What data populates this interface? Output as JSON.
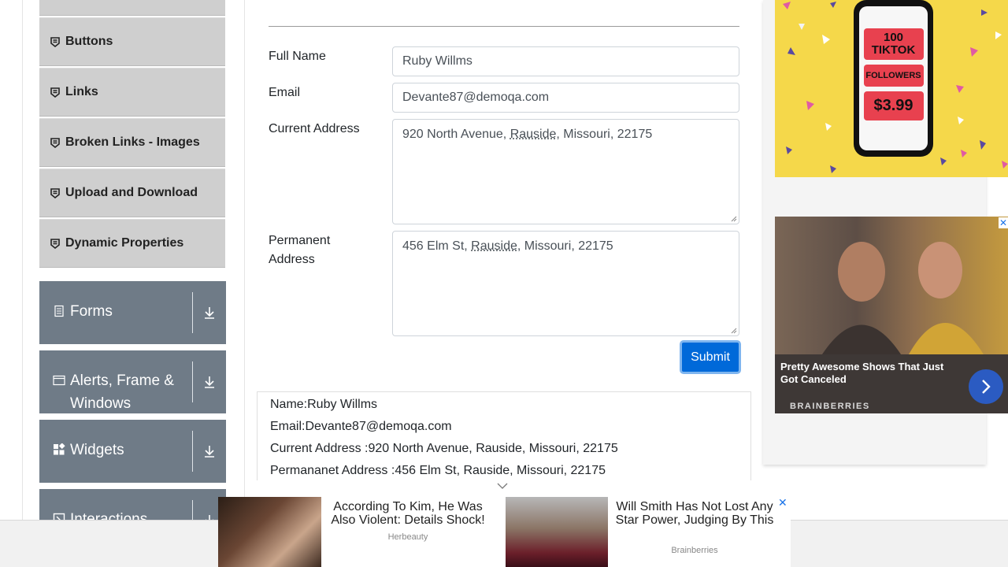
{
  "sidebar": {
    "element_items": [
      {
        "label": ""
      },
      {
        "label": "Buttons"
      },
      {
        "label": "Links"
      },
      {
        "label": "Broken Links - Images"
      },
      {
        "label": "Upload and Download"
      },
      {
        "label": "Dynamic Properties"
      }
    ],
    "groups": [
      {
        "label": "Forms",
        "icon": "form-icon"
      },
      {
        "label": "Alerts, Frame & Windows",
        "icon": "window-icon"
      },
      {
        "label": "Widgets",
        "icon": "widgets-icon"
      },
      {
        "label": "Interactions",
        "icon": "interactions-icon"
      }
    ]
  },
  "form": {
    "full_name_label": "Full Name",
    "full_name_value": "Ruby Willms",
    "email_label": "Email",
    "email_value": "Devante87@demoqa.com",
    "current_address_label": "Current Address",
    "current_address_pre": "920 North Avenue, ",
    "current_address_ul": "Rauside",
    "current_address_post": ", Missouri, 22175",
    "permanent_address_label_1": "Permanent",
    "permanent_address_label_2": "Address",
    "permanent_address_pre": "456 Elm St, ",
    "permanent_address_ul": "Rauside",
    "permanent_address_post": ", Missouri, 22175",
    "submit_label": "Submit"
  },
  "output": {
    "name": "Name:Ruby Willms",
    "email": "Email:Devante87@demoqa.com",
    "current_address": "Current Address :920 North Avenue, Rauside, Missouri, 22175",
    "permanent_address": "Permananet Address :456 Elm St, Rauside, Missouri, 22175"
  },
  "ads": {
    "tiktok": {
      "line1": "100",
      "line2": "TIKTOK",
      "line3": "FOLLOWERS",
      "price": "$3.99"
    },
    "shows": {
      "title": "Pretty Awesome Shows That Just Got Canceled",
      "brand": "BRAINBERRIES"
    },
    "bottom": [
      {
        "headline": "According To Kim, He Was Also Violent: Details Shock!",
        "source": "Herbeauty"
      },
      {
        "headline": "Will Smith Has Not Lost Any Star Power, Judging By This",
        "source": "Brainberries"
      }
    ]
  }
}
